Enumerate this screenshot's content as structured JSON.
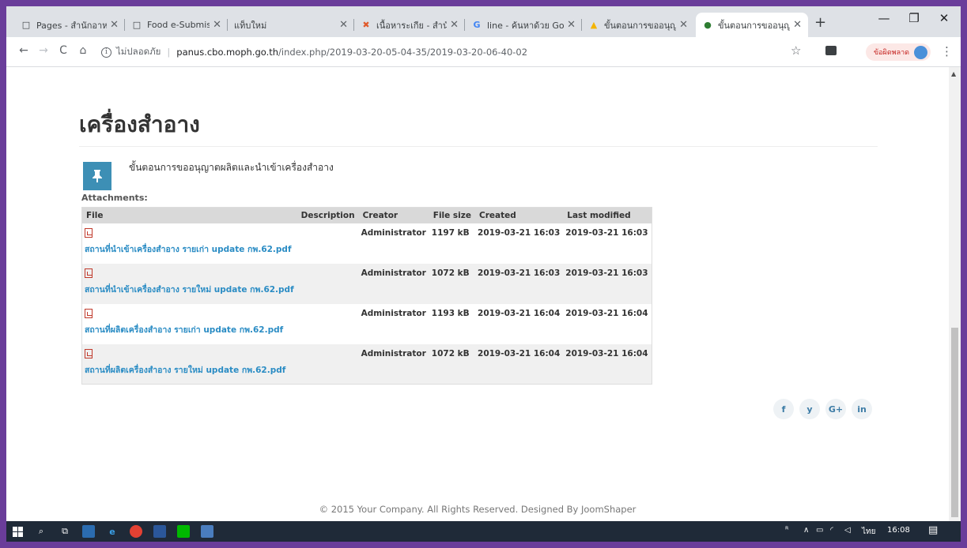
{
  "browser": {
    "tabs": [
      {
        "label": "Pages - สำนักอาหาร",
        "icon": "page-icon",
        "active": false
      },
      {
        "label": "Food e-Submission",
        "icon": "page-icon",
        "active": false
      },
      {
        "label": "แท็บใหม่",
        "icon": "",
        "active": false
      },
      {
        "label": "เนื้อหาระเกีย - สำนัก",
        "icon": "joomla-icon",
        "active": false
      },
      {
        "label": "line - ค้นหาด้วย Go",
        "icon": "google-icon",
        "active": false
      },
      {
        "label": "ขั้นตอนการขออนุญ",
        "icon": "drive-icon",
        "active": false
      },
      {
        "label": "ขั้นตอนการขออนุญ",
        "icon": "site-icon",
        "active": true
      }
    ],
    "new_tab": "+",
    "address": {
      "security": "ไม่ปลอดภัย",
      "host": "panus.cbo.moph.go.th",
      "path": "/index.php/2019-03-20-05-04-35/2019-03-20-06-40-02"
    },
    "error_button": "ข้อผิดพลาด"
  },
  "page": {
    "title": "เครื่องสำอาง",
    "doc_title": "ขั้นตอนการขออนุญาตผลิตและนำเข้าเครื่องสำอาง",
    "attachments_label": "Attachments:",
    "columns": [
      "File",
      "Description",
      "Creator",
      "File size",
      "Created",
      "Last modified"
    ],
    "rows": [
      {
        "file": "สถานที่นำเข้าเครื่องสำอาง รายเก่า update กพ.62.pdf",
        "description": "",
        "creator": "Administrator",
        "size": "1197 kB",
        "created": "2019-03-21 16:03",
        "modified": "2019-03-21 16:03"
      },
      {
        "file": "สถานที่นำเข้าเครื่องสำอาง รายใหม่ update กพ.62.pdf",
        "description": "",
        "creator": "Administrator",
        "size": "1072 kB",
        "created": "2019-03-21 16:03",
        "modified": "2019-03-21 16:03"
      },
      {
        "file": "สถานที่ผลิตเครื่องสำอาง รายเก่า update กพ.62.pdf",
        "description": "",
        "creator": "Administrator",
        "size": "1193 kB",
        "created": "2019-03-21 16:04",
        "modified": "2019-03-21 16:04"
      },
      {
        "file": "สถานที่ผลิตเครื่องสำอาง รายใหม่ update กพ.62.pdf",
        "description": "",
        "creator": "Administrator",
        "size": "1072 kB",
        "created": "2019-03-21 16:04",
        "modified": "2019-03-21 16:04"
      }
    ],
    "social": [
      "f",
      "y",
      "G+",
      "in"
    ],
    "footer": "© 2015 Your Company. All Rights Reserved. Designed By JoomShaper"
  },
  "taskbar": {
    "language": "ไทย",
    "time": "16:08"
  },
  "colors": {
    "accent": "#3d8fb5",
    "link": "#2a8cc4",
    "frame": "#6a3d9a"
  }
}
